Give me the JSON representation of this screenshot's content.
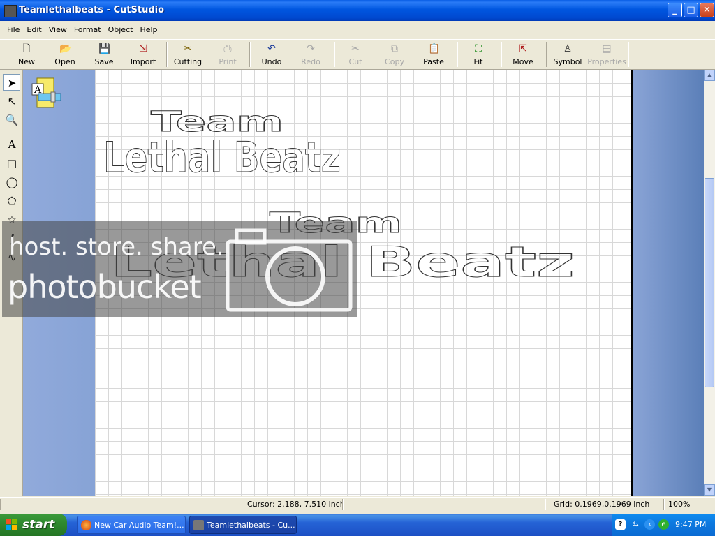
{
  "window": {
    "title": "Teamlethalbeats - CutStudio",
    "controls": {
      "minimize": "_",
      "maximize": "□",
      "close": "✕"
    }
  },
  "menu": [
    "File",
    "Edit",
    "View",
    "Format",
    "Object",
    "Help"
  ],
  "toolbar": [
    {
      "label": "New",
      "icon": "new-file-icon",
      "enabled": true
    },
    {
      "label": "Open",
      "icon": "open-folder-icon",
      "enabled": true
    },
    {
      "label": "Save",
      "icon": "save-disk-icon",
      "enabled": true
    },
    {
      "label": "Import",
      "icon": "import-icon",
      "enabled": true
    },
    {
      "label": "Cutting",
      "icon": "cutter-icon",
      "enabled": true
    },
    {
      "label": "Print",
      "icon": "printer-icon",
      "enabled": false
    },
    {
      "label": "Undo",
      "icon": "undo-icon",
      "enabled": true
    },
    {
      "label": "Redo",
      "icon": "redo-icon",
      "enabled": false
    },
    {
      "label": "Cut",
      "icon": "scissors-icon",
      "enabled": false
    },
    {
      "label": "Copy",
      "icon": "copy-icon",
      "enabled": false
    },
    {
      "label": "Paste",
      "icon": "paste-icon",
      "enabled": true
    },
    {
      "label": "Fit",
      "icon": "fit-icon",
      "enabled": true
    },
    {
      "label": "Move",
      "icon": "move-icon",
      "enabled": true
    },
    {
      "label": "Symbol",
      "icon": "symbol-icon",
      "enabled": true
    },
    {
      "label": "Properties",
      "icon": "properties-icon",
      "enabled": false
    }
  ],
  "left_tools": [
    "select-arrow-icon",
    "node-edit-icon",
    "zoom-icon",
    "text-icon",
    "rectangle-icon",
    "ellipse-icon",
    "polygon-icon",
    "star-icon",
    "bezier-icon",
    "freehand-icon"
  ],
  "canvas": {
    "artwork": [
      {
        "line1": "Team",
        "line2": "Lethal Beatz"
      },
      {
        "line1": "Team",
        "line2": "Lethal Beatz"
      }
    ]
  },
  "watermark": {
    "line1": "host. store. share.",
    "line2": "photobucket"
  },
  "status": {
    "cursor": "Cursor: 2.188, 7.510 inch",
    "grid": "Grid: 0.1969,0.1969 inch",
    "zoom": "100%"
  },
  "taskbar": {
    "start_label": "start",
    "tasks": [
      {
        "label": "New Car Audio Team!...",
        "active": false
      },
      {
        "label": "Teamlethalbeats - Cu...",
        "active": true
      }
    ],
    "clock": "9:47 PM"
  }
}
